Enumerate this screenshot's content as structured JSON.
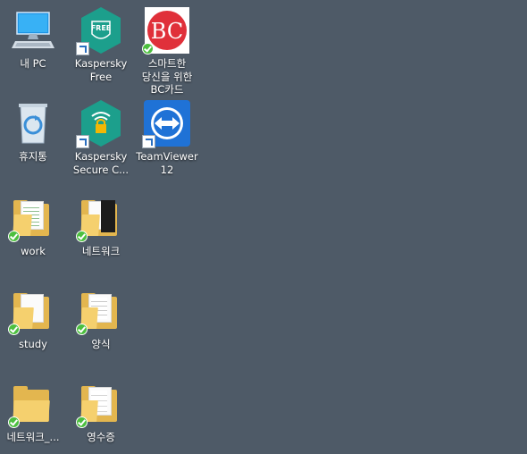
{
  "desktop": {
    "background": "#4e5a67",
    "icons": [
      {
        "label": "내 PC",
        "icon": "computer-icon"
      },
      {
        "label": "Kaspersky\nFree",
        "icon": "kaspersky-free-icon",
        "badge_text": "FREE"
      },
      {
        "label": "스마트한\n당신을 위한\nBC카드",
        "icon": "bc-card-icon",
        "badge_text": "BC"
      },
      {
        "label": "휴지통",
        "icon": "recycle-bin-icon"
      },
      {
        "label": "Kaspersky\nSecure C...",
        "icon": "kaspersky-secure-icon"
      },
      {
        "label": "TeamViewer\n12",
        "icon": "teamviewer-icon"
      },
      {
        "label": "work",
        "icon": "folder-icon"
      },
      {
        "label": "네트워크",
        "icon": "folder-icon"
      },
      {
        "label": "study",
        "icon": "folder-icon"
      },
      {
        "label": "양식",
        "icon": "folder-icon"
      },
      {
        "label": "네트워크_...",
        "icon": "folder-icon"
      },
      {
        "label": "영수증",
        "icon": "folder-icon"
      }
    ]
  },
  "colors": {
    "kaspersky": "#1c9f8c",
    "bc_red": "#e0303a",
    "teamviewer": "#1f72d6",
    "sync_ok": "#4cbf3f"
  }
}
